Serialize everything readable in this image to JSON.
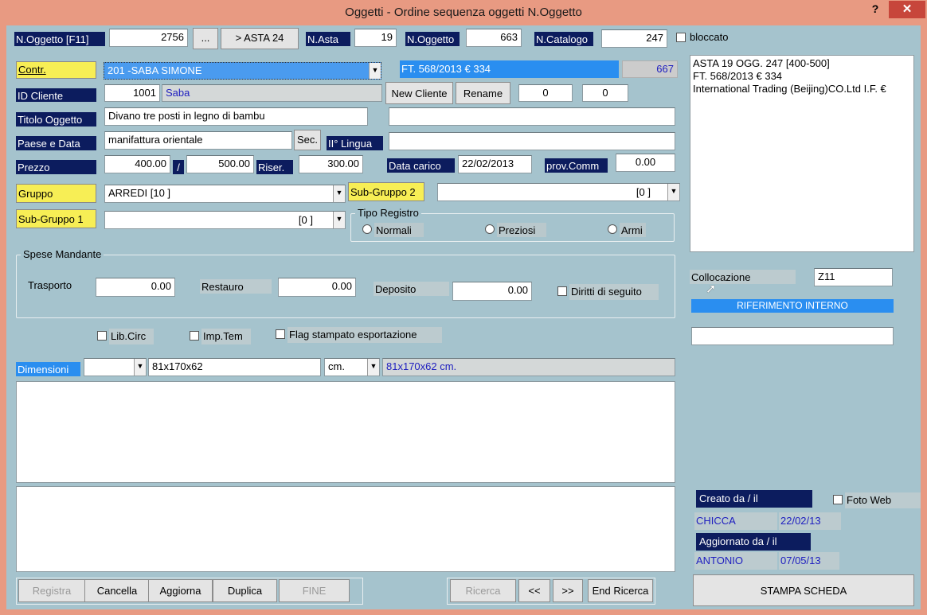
{
  "window": {
    "title": "Oggetti - Ordine sequenza oggetti N.Oggetto",
    "help": "?",
    "close": "✕"
  },
  "top": {
    "n_oggetto_label": "N.Oggetto [F11]",
    "n_oggetto_value": "2756",
    "dots_button": "...",
    "asta_button": "> ASTA 24",
    "n_asta_label": "N.Asta",
    "n_asta_value": "19",
    "n_oggetto2_label": "N.Oggetto",
    "n_oggetto2_value": "663",
    "n_catalogo_label": "N.Catalogo",
    "n_catalogo_value": "247",
    "bloccato_label": "bloccato"
  },
  "form": {
    "contr_label": "Contr.",
    "contr_value": "201  -SABA SIMONE",
    "ft_value": "FT. 568/2013 € 334",
    "ft_number": "667",
    "id_cliente_label": "ID Cliente",
    "id_cliente_value": "1001",
    "cliente_name": "Saba",
    "new_cliente_button": "New Cliente",
    "rename_button": "Rename",
    "counter1": "0",
    "counter2": "0",
    "titolo_label": "Titolo Oggetto",
    "titolo_value": "Divano tre posti in legno di bambu",
    "paese_label": "Paese e Data",
    "paese_value": "manifattura orientale",
    "sec_button": "Sec.",
    "lingua_label": "II° Lingua",
    "prezzo_label": "Prezzo",
    "prezzo_min": "400.00",
    "slash": "/",
    "prezzo_max": "500.00",
    "riser_label": "Riser.",
    "riser_value": "300.00",
    "data_carico_label": "Data carico",
    "data_carico_value": "22/02/2013",
    "prov_label": "prov.Comm",
    "prov_value": "0.00",
    "gruppo_label": "Gruppo",
    "gruppo_value": "ARREDI [10  ]",
    "subgruppo2_label": "Sub-Gruppo 2",
    "subgruppo2_value": "[0   ]",
    "subgruppo1_label": "Sub-Gruppo 1",
    "subgruppo1_value": "[0   ]",
    "tipo_registro_title": "Tipo Registro",
    "radio_normali": "Normali",
    "radio_preziosi": "Preziosi",
    "radio_armi": "Armi"
  },
  "spese": {
    "title": "Spese Mandante",
    "trasporto_label": "Trasporto",
    "trasporto_value": "0.00",
    "restauro_label": "Restauro",
    "restauro_value": "0.00",
    "deposito_label": "Deposito",
    "deposito_value": "0.00",
    "diritti_label": "Diritti di seguito"
  },
  "flags": {
    "lib_circ": "Lib.Circ",
    "imp_tem": "Imp.Tem",
    "flag_stampato": "Flag stampato esportazione"
  },
  "dimensioni": {
    "label": "Dimensioni",
    "value": "81x170x62",
    "unit": "cm.",
    "preview": "81x170x62 cm."
  },
  "notes": {
    "lines": [
      "ASTA 19 OGG. 247 [400-500]",
      "FT. 568/2013 € 334",
      "International Trading (Beijing)CO.Ltd I.F. €"
    ]
  },
  "right": {
    "collocazione_label": "Collocazione",
    "collocazione_value": "Z11",
    "riferimento_label": "RIFERIMENTO INTERNO",
    "creato_label": "Creato da / il",
    "foto_web_label": "Foto Web",
    "creato_user": "CHICCA",
    "creato_date": "22/02/13",
    "aggiornato_label": "Aggiornato da / il",
    "aggiornato_user": "ANTONIO",
    "aggiornato_date": "07/05/13",
    "stampa_button": "STAMPA SCHEDA"
  },
  "bottom": {
    "registra": "Registra",
    "cancella": "Cancella",
    "aggiorna": "Aggiorna",
    "duplica": "Duplica",
    "fine": "FINE",
    "ricerca": "Ricerca",
    "prev": "<<",
    "next": ">>",
    "end_ricerca": "End Ricerca"
  },
  "colors": {
    "client_bg": "#a5c3cd",
    "titlebar_bg": "#e89a82",
    "navy_label": "#0c1c5e",
    "yellow_label": "#f7ee55",
    "accent_blue": "#2a8ef0",
    "close_red": "#c7463b"
  }
}
